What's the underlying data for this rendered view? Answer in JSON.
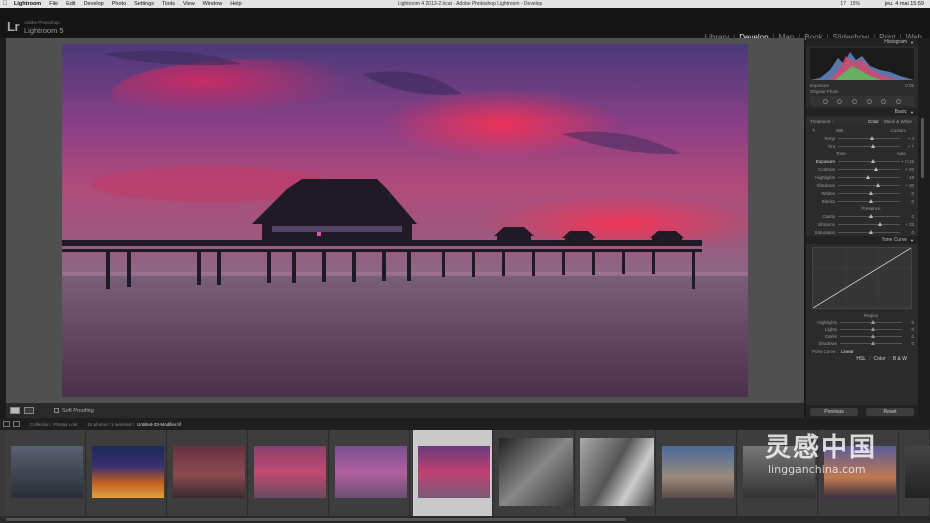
{
  "menubar": {
    "app": "Lightroom",
    "items": [
      "File",
      "Edit",
      "Develop",
      "Photo",
      "Settings",
      "Tools",
      "View",
      "Window",
      "Help"
    ],
    "window_title": "Lightroom 4 2013-2.lrcat - Adobe Photoshop Lightroom - Develop",
    "status": [
      "17",
      "15%"
    ],
    "clock": "jeu. 4 mai 15:59"
  },
  "identity": {
    "logo": "Lr",
    "subtitle": "Adobe Photoshop",
    "name": "Lightroom 5"
  },
  "modules": {
    "items": [
      "Library",
      "Develop",
      "Map",
      "Book",
      "Slideshow",
      "Print",
      "Web"
    ],
    "active": "Develop"
  },
  "toolbar": {
    "soft_proofing": "Soft Proofing"
  },
  "right_panel": {
    "histogram_title": "Histogram",
    "info_left": "Exposure",
    "info_right": "0.05",
    "original_photo": "Original Photo",
    "basic_title": "Basic",
    "treatment_label": "Treatment :",
    "treatment_color": "Color",
    "treatment_bw": "Black & White",
    "wb_label": "WB :",
    "wb_value": "Custom",
    "temp_label": "Temp",
    "temp_value": "+ 4",
    "tint_label": "Tint",
    "tint_value": "+ 7",
    "tone_label": "Tone",
    "auto_label": "Auto",
    "exposure_label": "Exposure",
    "exposure_value": "+ 0.15",
    "contrast_label": "Contrast",
    "contrast_value": "+ 20",
    "highlights_label": "Highlights",
    "highlights_value": "- 18",
    "shadows_label": "Shadows",
    "shadows_value": "+ 30",
    "whites_label": "Whites",
    "whites_value": "0",
    "blacks_label": "Blacks",
    "blacks_value": "0",
    "presence_label": "Presence",
    "clarity_label": "Clarity",
    "clarity_value": "0",
    "vibrance_label": "Vibrance",
    "vibrance_value": "+ 33",
    "saturation_label": "Saturation",
    "saturation_value": "0",
    "tone_curve_title": "Tone Curve",
    "region_label": "Region",
    "highlights_r": "Highlights",
    "lights_r": "Lights",
    "darks_r": "Darks",
    "shadows_r": "Shadows",
    "region_val": "0",
    "point_curve_label": "Point Curve :",
    "point_curve_value": "Linear",
    "hsl": "HSL",
    "color": "Color",
    "bw": "B & W",
    "previous": "Previous",
    "reset": "Reset"
  },
  "filmstrip_bar": {
    "collection": "Collection : Photos Loot",
    "count": "16 photos / 1 selected /",
    "filename": "Untitled-33-Modifier.tif"
  },
  "watermark": {
    "cn": "灵感中国",
    "url": "lingganchina.com"
  }
}
